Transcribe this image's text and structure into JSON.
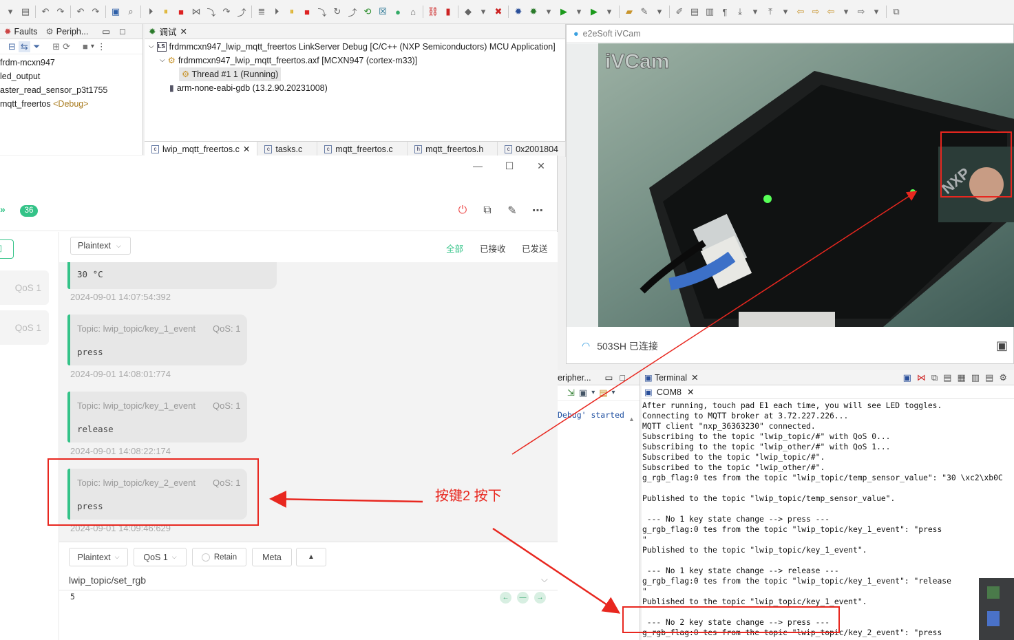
{
  "ide": {
    "left_tabs": [
      {
        "label": "Faults"
      },
      {
        "label": "Periph..."
      }
    ],
    "left_tree": [
      {
        "text": "frdm-mcxn947",
        "tag": ""
      },
      {
        "text": "led_output",
        "tag": ""
      },
      {
        "text": "aster_read_sensor_p3t1755",
        "tag": ""
      },
      {
        "text": "mqtt_freertos",
        "tag": "<Debug>"
      }
    ],
    "debug_tab": "调试",
    "debug_tree": [
      {
        "icon": "LS",
        "text": "frdmmcxn947_lwip_mqtt_freertos LinkServer Debug [C/C++ (NXP Semiconductors) MCU Application]"
      },
      {
        "icon": "axf",
        "text": "frdmmcxn947_lwip_mqtt_freertos.axf [MCXN947 (cortex-m33)]"
      },
      {
        "icon": "thread",
        "text": "Thread #1 1 (Running)"
      },
      {
        "icon": "gdb",
        "text": "arm-none-eabi-gdb (13.2.90.20231008)"
      }
    ],
    "editor_tabs": [
      {
        "label": "lwip_mqtt_freertos.c",
        "closable": true
      },
      {
        "label": "tasks.c",
        "closable": false
      },
      {
        "label": "mqtt_freertos.c",
        "closable": false
      },
      {
        "label": "mqtt_freertos.h",
        "closable": false
      },
      {
        "label": "0x2001804",
        "closable": false
      }
    ]
  },
  "mqtt": {
    "message_count": "36",
    "sidebar_items": [
      {
        "qos": "QoS 1"
      },
      {
        "qos": "QoS 1"
      }
    ],
    "sidebar_button_fragment": "间",
    "format_select": "Plaintext",
    "filters": {
      "all": "全部",
      "received": "已接收",
      "sent": "已发送"
    },
    "messages": [
      {
        "topic": "",
        "qos": "",
        "payload": "30 °C",
        "time": "2024-09-01 14:07:54:392"
      },
      {
        "topic": "Topic: lwip_topic/key_1_event",
        "qos": "QoS: 1",
        "payload": "press",
        "time": "2024-09-01 14:08:01:774"
      },
      {
        "topic": "Topic: lwip_topic/key_1_event",
        "qos": "QoS: 1",
        "payload": "release",
        "time": "2024-09-01 14:08:22:174"
      },
      {
        "topic": "Topic: lwip_topic/key_2_event",
        "qos": "QoS: 1",
        "payload": "press",
        "time": "2024-09-01 14:09:46:629"
      }
    ],
    "compose": {
      "format": "Plaintext",
      "qos": "QoS 1",
      "retain": "Retain",
      "meta": "Meta",
      "topic": "lwip_topic/set_rgb",
      "payload": "5"
    }
  },
  "camera": {
    "title": "e2eSoft iVCam",
    "watermark": "iVCam",
    "board_logo": "NXP",
    "status": "503SH 已连接"
  },
  "periph": {
    "tab": "eripher...",
    "log_text": "Debug' started"
  },
  "terminal": {
    "tab": "Terminal",
    "port": "COM8",
    "lines": [
      "After running, touch pad E1 each time, you will see LED toggles.",
      "Connecting to MQTT broker at 3.72.227.226...",
      "MQTT client \"nxp_36363230\" connected.",
      "Subscribing to the topic \"lwip_topic/#\" with QoS 0...",
      "Subscribing to the topic \"lwip_other/#\" with QoS 1...",
      "Subscribed to the topic \"lwip_topic/#\".",
      "Subscribed to the topic \"lwip_other/#\".",
      "g_rgb_flag:0 tes from the topic \"lwip_topic/temp_sensor_value\": \"30 \\xc2\\xb0C",
      "",
      "Published to the topic \"lwip_topic/temp_sensor_value\".",
      "",
      " --- No 1 key state change --> press ---",
      "g_rgb_flag:0 tes from the topic \"lwip_topic/key_1_event\": \"press",
      "\"",
      "Published to the topic \"lwip_topic/key_1_event\".",
      "",
      " --- No 1 key state change --> release ---",
      "g_rgb_flag:0 tes from the topic \"lwip_topic/key_1_event\": \"release",
      "\"",
      "Published to the topic \"lwip_topic/key_1_event\".",
      "",
      " --- No 2 key state change --> press ---",
      "g_rgb_flag:0 tes from the topic \"lwip_topic/key_2_event\": \"press"
    ]
  },
  "annotation": {
    "label": "按键2 按下",
    "color": "#e8271f"
  },
  "colors": {
    "accent": "#34c388",
    "annotation": "#e8271f"
  }
}
